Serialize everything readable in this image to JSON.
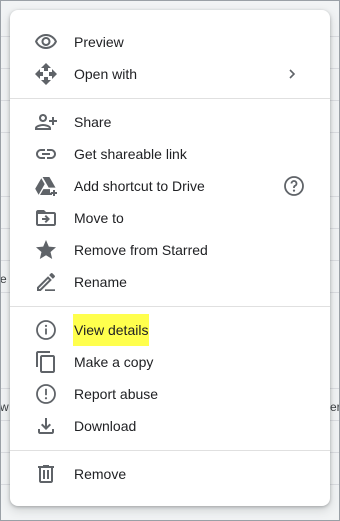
{
  "colors": {
    "menu_bg": "#ffffff",
    "text": "#202124",
    "icon": "#5f6368",
    "highlight": "#ffff4d",
    "divider": "#e0e0e0"
  },
  "background": {
    "frag_left_1": "e",
    "frag_left_2": "w",
    "frag_right": "er"
  },
  "menu": {
    "items": [
      {
        "label": "Preview",
        "icon": "eye-icon"
      },
      {
        "label": "Open with",
        "icon": "move-arrows-icon",
        "submenu": "chevron-right-icon"
      },
      {
        "label": "Share",
        "icon": "person-add-icon"
      },
      {
        "label": "Get shareable link",
        "icon": "link-icon"
      },
      {
        "label": "Add shortcut to Drive",
        "icon": "drive-shortcut-icon",
        "help": "help-circle-icon"
      },
      {
        "label": "Move to",
        "icon": "move-to-folder-icon"
      },
      {
        "label": "Remove from Starred",
        "icon": "star-icon"
      },
      {
        "label": "Rename",
        "icon": "pencil-icon"
      },
      {
        "label": "View details",
        "icon": "info-icon",
        "highlighted": true
      },
      {
        "label": "Make a copy",
        "icon": "copy-icon"
      },
      {
        "label": "Report abuse",
        "icon": "report-icon"
      },
      {
        "label": "Download",
        "icon": "download-icon"
      },
      {
        "label": "Remove",
        "icon": "trash-icon"
      }
    ]
  }
}
